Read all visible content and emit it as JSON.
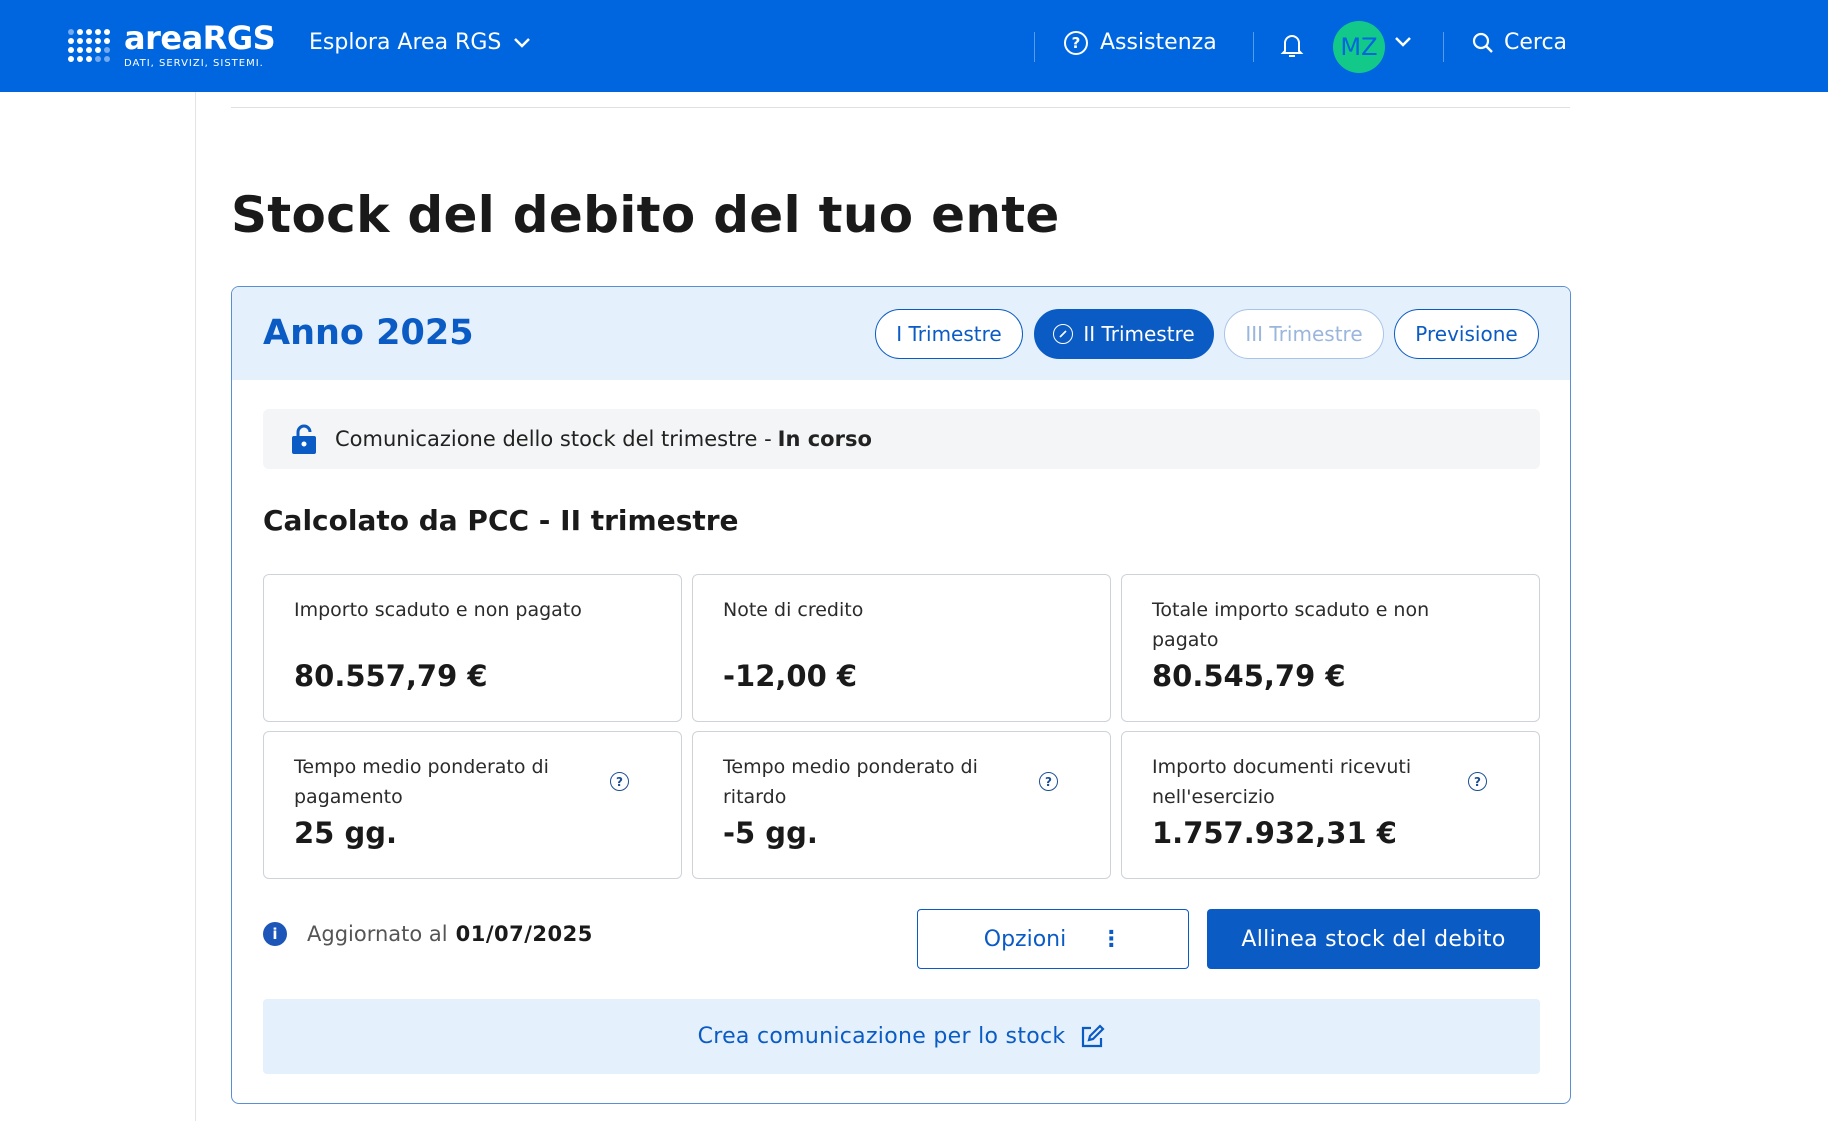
{
  "header": {
    "logo_main": "areaRGS",
    "logo_sub": "DATI, SERVIZI, SISTEMI.",
    "explore_label": "Esplora Area RGS",
    "assist_label": "Assistenza",
    "avatar_initials": "MZ",
    "search_label": "Cerca",
    "bar_color": "#0066e0"
  },
  "page": {
    "title": "Stock del debito del tuo ente"
  },
  "card": {
    "year_title": "Anno 2025",
    "tabs": [
      {
        "label": "I Trimestre",
        "state": "default"
      },
      {
        "label": "II Trimestre",
        "state": "active"
      },
      {
        "label": "III Trimestre",
        "state": "disabled"
      },
      {
        "label": "Previsione",
        "state": "default"
      }
    ],
    "status": {
      "text": "Comunicazione dello stock del trimestre -",
      "value": "In corso",
      "icon": "lock-icon"
    },
    "section_title": "Calcolato da PCC - II trimestre",
    "tiles": [
      {
        "label": "Importo scaduto e non pagato",
        "value": "80.557,79 €"
      },
      {
        "label": "Note di credito",
        "value": "-12,00 €"
      },
      {
        "label": "Totale importo scaduto e non pagato",
        "value": "80.545,79 €"
      },
      {
        "label": "Tempo medio ponderato di pagamento",
        "value": "25 gg."
      },
      {
        "label": "Tempo medio ponderato di ritardo",
        "value": "-5 gg."
      },
      {
        "label": "Importo documenti ricevuti nell'esercizio",
        "value": "1.757.932,31 €"
      }
    ],
    "updated": {
      "label": "Aggiornato al",
      "date": "01/07/2025"
    },
    "options_label": "Opzioni",
    "align_label": "Allinea stock del debito",
    "create_label": "Crea comunicazione per lo stock",
    "accent_color": "#0b5bc4"
  }
}
